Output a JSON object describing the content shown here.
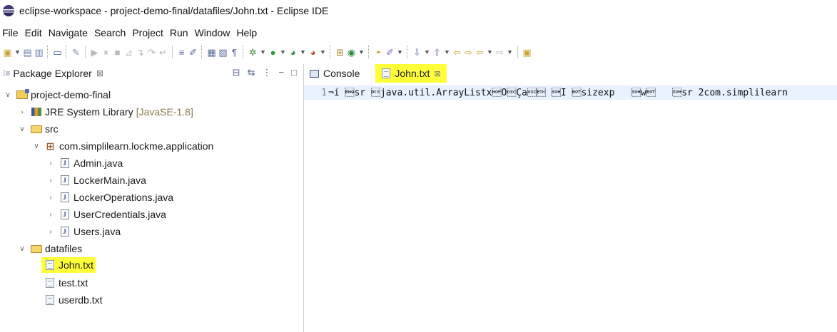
{
  "window": {
    "title": "eclipse-workspace - project-demo-final/datafiles/John.txt - Eclipse IDE"
  },
  "menu": [
    "File",
    "Edit",
    "Navigate",
    "Search",
    "Project",
    "Run",
    "Window",
    "Help"
  ],
  "package_explorer": {
    "title": "Package Explorer",
    "close_glyph": "⊠",
    "tree": {
      "project": "project-demo-final",
      "jre": {
        "label": "JRE System Library",
        "suffix": "[JavaSE-1.8]"
      },
      "src": "src",
      "package": "com.simplilearn.lockme.application",
      "java_files": [
        "Admin.java",
        "LockerMain.java",
        "LockerOperations.java",
        "UserCredentials.java",
        "Users.java"
      ],
      "datafiles": "datafiles",
      "data_files": [
        "John.txt",
        "test.txt",
        "userdb.txt"
      ]
    }
  },
  "editor": {
    "tabs": [
      {
        "label": "Console"
      },
      {
        "label": "John.txt",
        "close_glyph": "⊠",
        "highlight_color": "#ffff3a"
      }
    ],
    "line_number": "1",
    "line_content": "¬í \u0005sr \u0013java.util.ArrayListxÒÇa\u0003 \u0001I \u0004sizexp   \u0001w\u0004   \u0001sr 2com.simplilearn"
  },
  "colors": {
    "highlight": "#ffff3a",
    "current_line": "#e8f2fe"
  }
}
